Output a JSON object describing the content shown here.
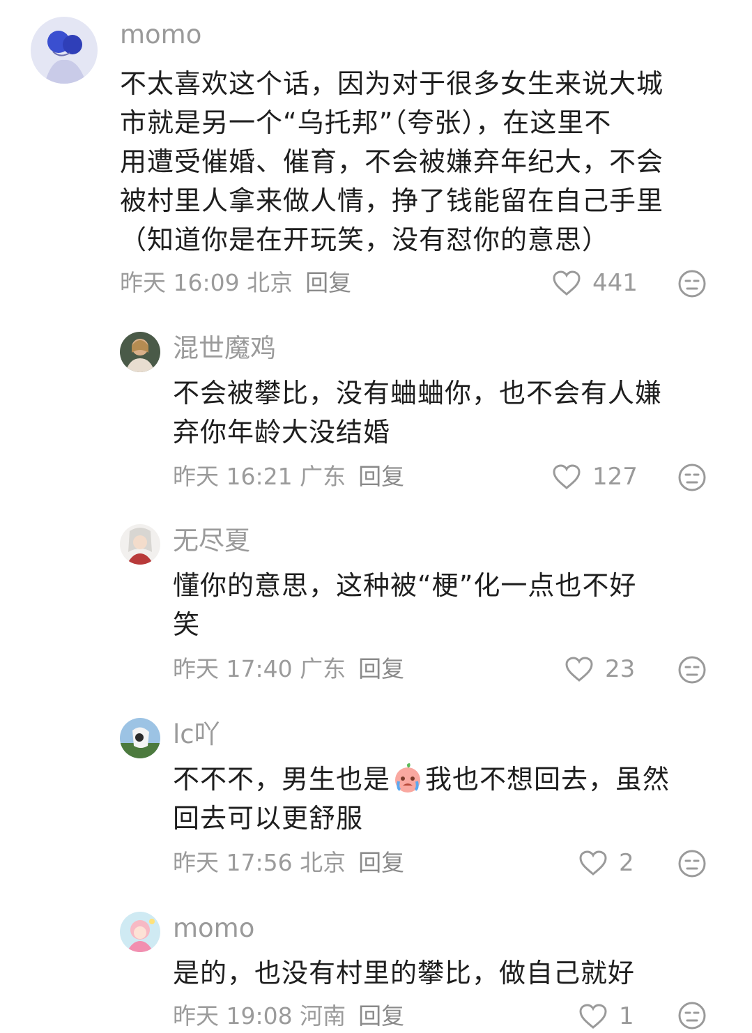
{
  "comments": [
    {
      "username": "momo",
      "lines": [
        "不太喜欢这个话，因为对于很多女生来说大城",
        "市就是另一个“乌托邦”（夸张），在这里不",
        "用遭受催婚、催育，不会被嫌弃年纪大，不会",
        "被村里人拿来做人情，挣了钱能留在自己手里",
        "（知道你是在开玩笑，没有怼你的意思）"
      ],
      "time": "昨天 16:09 北京",
      "reply_label": "回复",
      "likes": "441",
      "avatar_icon": "avatar-couple-illustration"
    },
    {
      "username": "混世魔鸡",
      "lines": [
        "不会被攀比，没有蛐蛐你，也不会有人嫌",
        "弃你年龄大没结婚"
      ],
      "time": "昨天 16:21 广东",
      "reply_label": "回复",
      "likes": "127",
      "avatar_icon": "avatar-woman-photo"
    },
    {
      "username": "无尽夏",
      "lines": [
        "懂你的意思，这种被“梗”化一点也不好",
        "笑"
      ],
      "time": "昨天 17:40 广东",
      "reply_label": "回复",
      "likes": "23",
      "avatar_icon": "avatar-anime-character"
    },
    {
      "username": "lc吖",
      "line1_before": "不不不，男生也是",
      "line1_after": "我也不想回去，虽然",
      "line2": "回去可以更舒服",
      "time": "昨天 17:56 北京",
      "reply_label": "回复",
      "likes": "2",
      "avatar_icon": "avatar-cow-landscape",
      "emoji_icon": "crying-peach-emoji"
    },
    {
      "username": "momo",
      "lines": [
        "是的，也没有村里的攀比，做自己就好"
      ],
      "time": "昨天 19:08 河南",
      "reply_label": "回复",
      "likes": "1",
      "avatar_icon": "avatar-pink-cartoon-girl"
    }
  ],
  "icons": {
    "like": "heart-outline-icon",
    "dislike": "meh-face-icon"
  },
  "colors": {
    "text": "#1e1e1e",
    "muted": "#9a9a9a",
    "background": "#ffffff"
  }
}
